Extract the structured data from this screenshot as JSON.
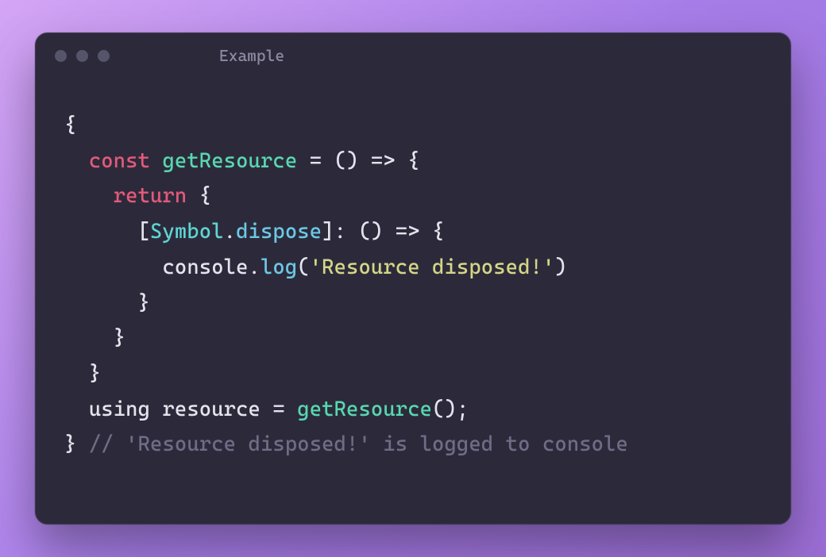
{
  "window": {
    "title": "Example"
  },
  "code": {
    "line1": {
      "brace": "{"
    },
    "line2": {
      "indent": "  ",
      "kw": "const",
      "sp1": " ",
      "fn": "getResource",
      "sp2": " ",
      "eq": "=",
      "sp3": " ",
      "parens": "()",
      "sp4": " ",
      "arrow": "=>",
      "sp5": " ",
      "brace": "{"
    },
    "line3": {
      "indent": "    ",
      "kw": "return",
      "sp": " ",
      "brace": "{"
    },
    "line4": {
      "indent": "      ",
      "lb": "[",
      "builtin": "Symbol",
      "dot": ".",
      "member": "dispose",
      "rb": "]",
      "colon": ":",
      "sp1": " ",
      "parens": "()",
      "sp2": " ",
      "arrow": "=>",
      "sp3": " ",
      "brace": "{"
    },
    "line5": {
      "indent": "        ",
      "obj": "console",
      "dot": ".",
      "method": "log",
      "lp": "(",
      "str": "'Resource disposed!'",
      "rp": ")"
    },
    "line6": {
      "indent": "      ",
      "brace": "}"
    },
    "line7": {
      "indent": "    ",
      "brace": "}"
    },
    "line8": {
      "indent": "  ",
      "brace": "}"
    },
    "line9": {
      "indent": "  ",
      "kw": "using",
      "sp1": " ",
      "ident": "resource",
      "sp2": " ",
      "eq": "=",
      "sp3": " ",
      "fn": "getResource",
      "parens": "()",
      "semi": ";"
    },
    "line10": {
      "brace": "}",
      "sp": " ",
      "comment": "// 'Resource disposed!' is logged to console"
    }
  }
}
